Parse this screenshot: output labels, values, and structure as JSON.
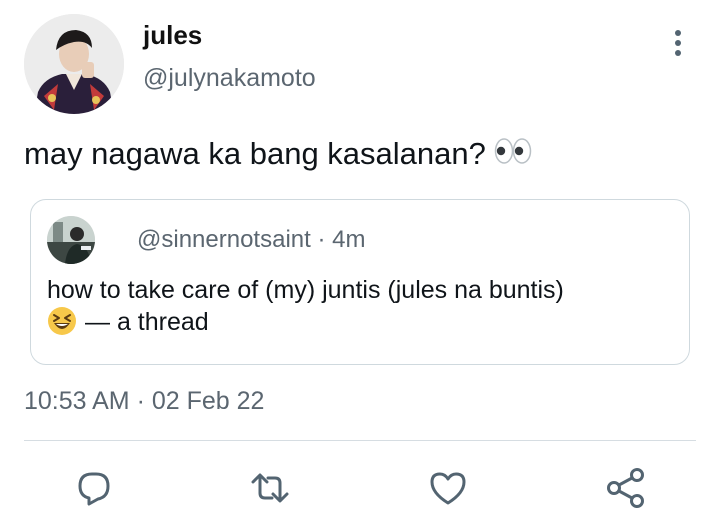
{
  "author": {
    "display_name": "jules",
    "handle": "@julynakamoto"
  },
  "tweet": {
    "text": "may nagawa ka bang kasalanan?",
    "emoji": "👀",
    "timestamp_time": "10:53 AM",
    "timestamp_sep": "·",
    "timestamp_date": "02 Feb 22"
  },
  "quoted_tweet": {
    "handle": "@sinnernotsaint",
    "sep": "·",
    "age": "4m",
    "text_line1": "how to take care of (my) juntis (jules na buntis)",
    "emoji": "😆",
    "text_line2": "— a thread"
  },
  "actions": [
    {
      "icon": "reply-icon"
    },
    {
      "icon": "retweet-icon"
    },
    {
      "icon": "like-icon"
    },
    {
      "icon": "share-icon"
    }
  ],
  "colors": {
    "text": "#0f1419",
    "secondary": "#5b6670",
    "border": "#cfd9de",
    "icon": "#536471"
  }
}
